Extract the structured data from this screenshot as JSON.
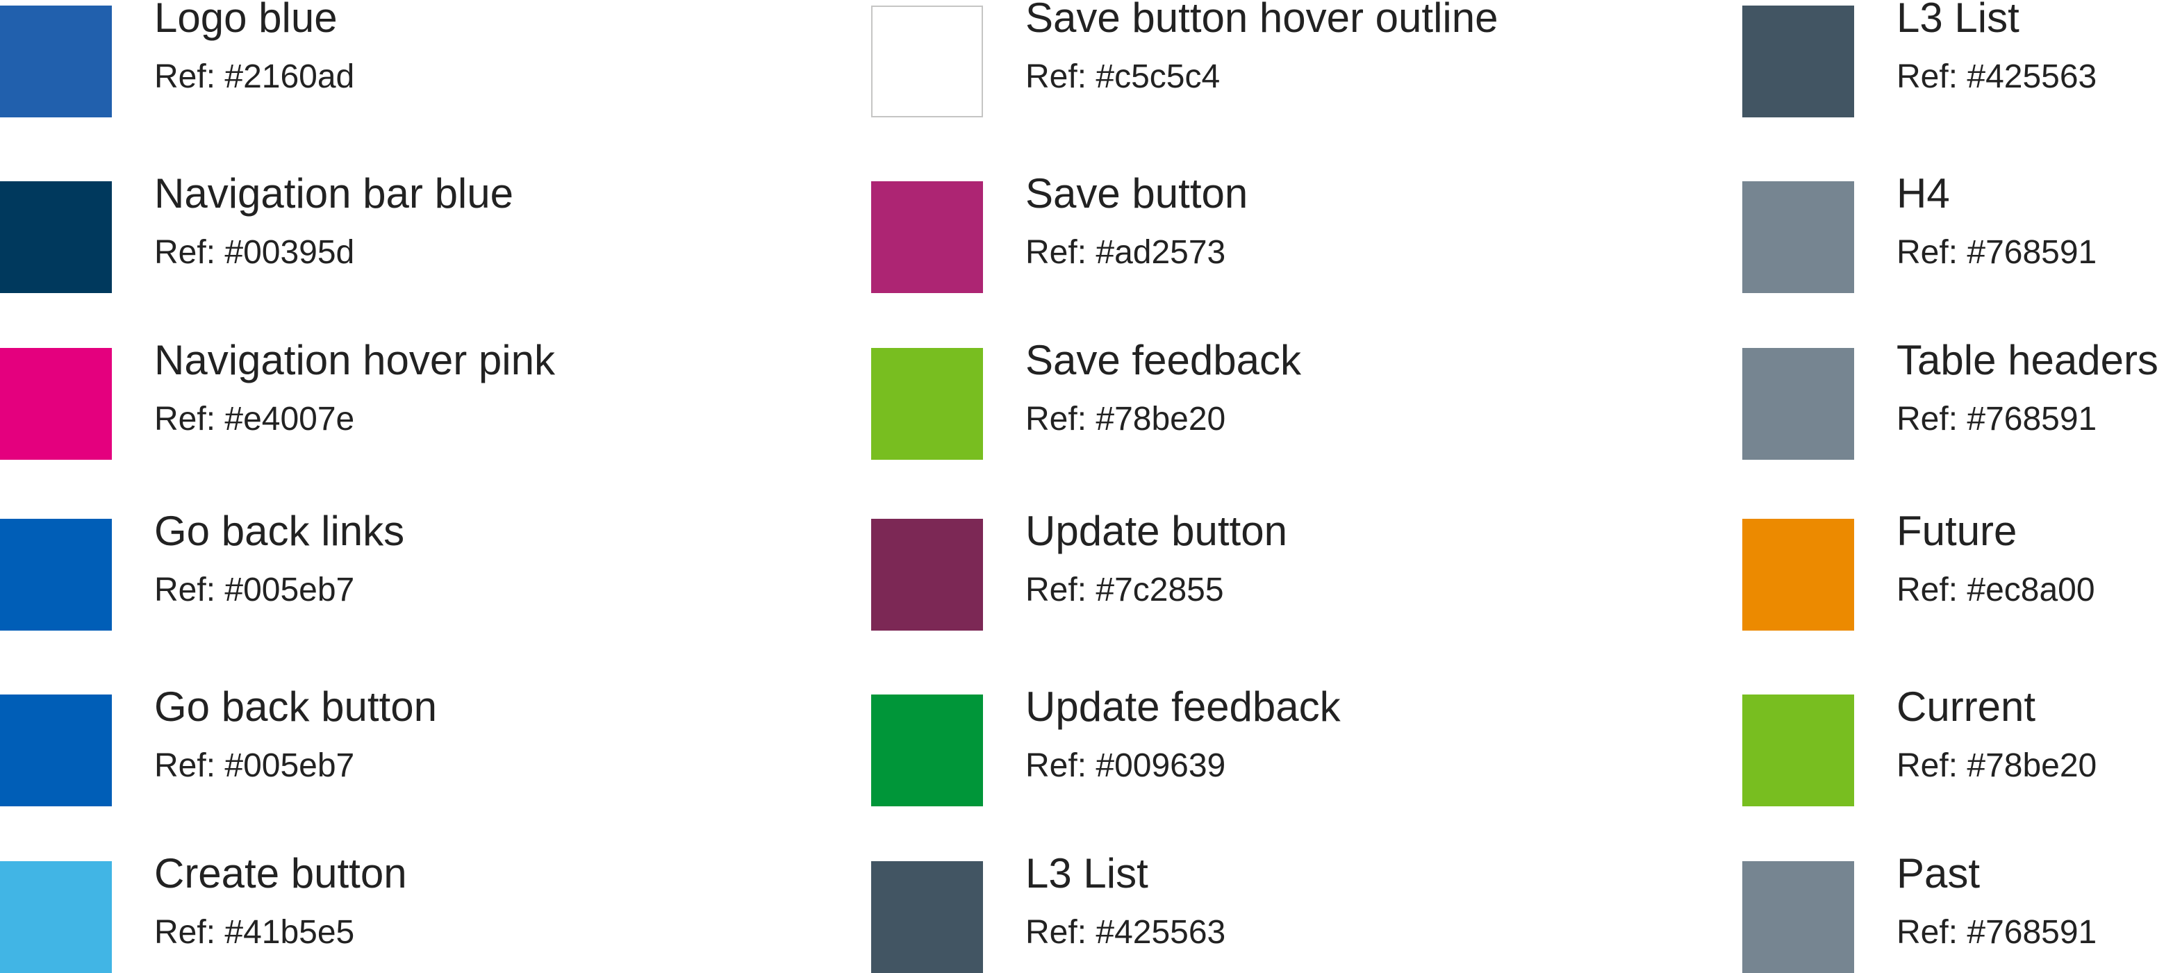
{
  "columns": [
    {
      "swatches": [
        {
          "name": "Logo blue",
          "ref": "Ref: #2160ad",
          "color": "#2160ad"
        },
        {
          "name": "Navigation bar blue",
          "ref": "Ref: #00395d",
          "color": "#00395d"
        },
        {
          "name": "Navigation hover pink",
          "ref": "Ref: #e4007e",
          "color": "#e4007e"
        },
        {
          "name": "Go back links",
          "ref": "Ref: #005eb7",
          "color": "#005eb7"
        },
        {
          "name": "Go back button",
          "ref": "Ref: #005eb7",
          "color": "#005eb7"
        },
        {
          "name": "Create button",
          "ref": "Ref: #41b5e5",
          "color": "#41b5e5"
        }
      ]
    },
    {
      "swatches": [
        {
          "name": "Save button hover outline",
          "ref": "Ref: #c5c5c4",
          "color": "#ffffff",
          "outline": "#c5c5c4"
        },
        {
          "name": "Save button",
          "ref": "Ref: #ad2573",
          "color": "#ad2573"
        },
        {
          "name": "Save feedback",
          "ref": "Ref: #78be20",
          "color": "#78be20"
        },
        {
          "name": "Update button",
          "ref": "Ref: #7c2855",
          "color": "#7c2855"
        },
        {
          "name": "Update feedback",
          "ref": "Ref: #009639",
          "color": "#009639"
        },
        {
          "name": "L3 List",
          "ref": "Ref: #425563",
          "color": "#425563"
        }
      ]
    },
    {
      "swatches": [
        {
          "name": "L3 List",
          "ref": "Ref: #425563",
          "color": "#425563"
        },
        {
          "name": "H4",
          "ref": "Ref: #768591",
          "color": "#768591"
        },
        {
          "name": "Table headers",
          "ref": "Ref: #768591",
          "color": "#768591"
        },
        {
          "name": "Future",
          "ref": "Ref: #ec8a00",
          "color": "#ec8a00"
        },
        {
          "name": "Current",
          "ref": "Ref: #78be20",
          "color": "#78be20"
        },
        {
          "name": "Past",
          "ref": "Ref: #768591",
          "color": "#768591"
        }
      ]
    }
  ]
}
